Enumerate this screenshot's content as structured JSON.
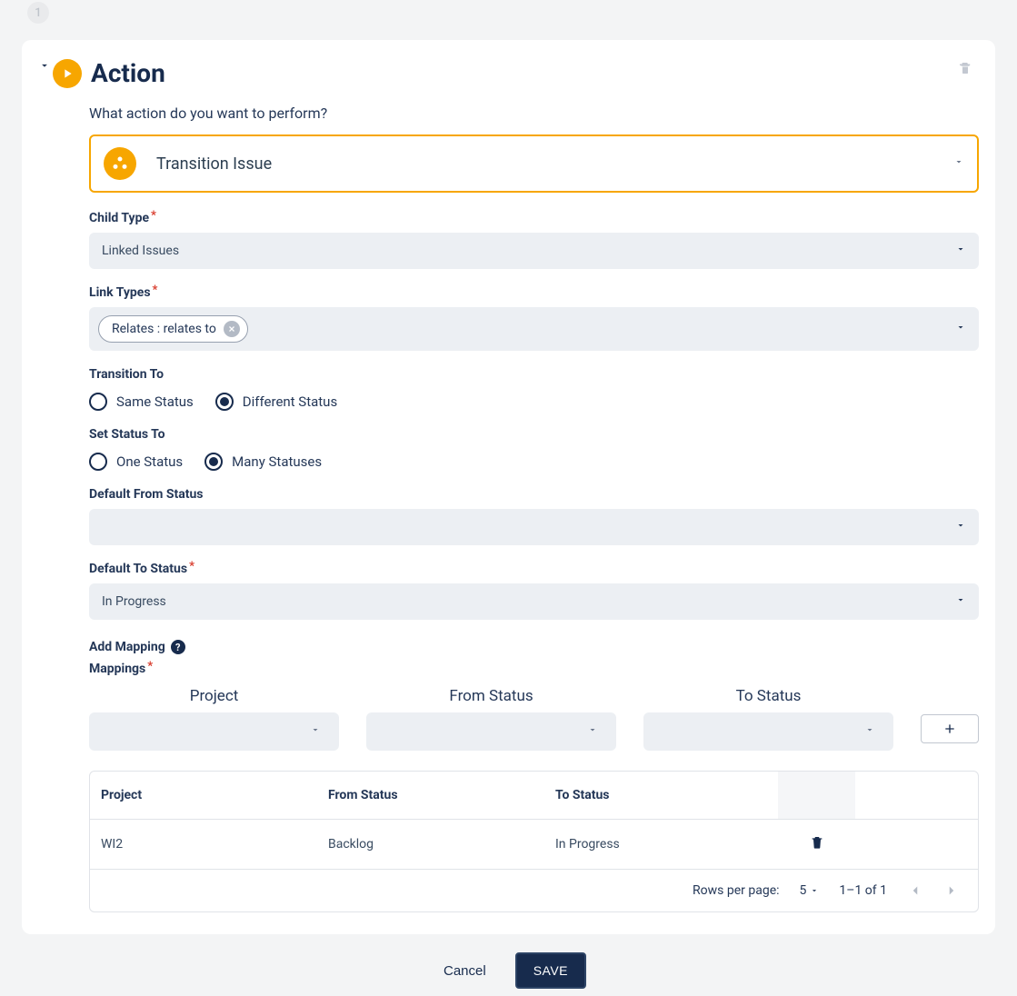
{
  "stepNumber": "1",
  "header": {
    "title": "Action"
  },
  "prompt": "What action do you want to perform?",
  "actionSelect": {
    "value": "Transition Issue"
  },
  "childType": {
    "label": "Child Type",
    "value": "Linked Issues"
  },
  "linkTypes": {
    "label": "Link Types",
    "chip": "Relates : relates to"
  },
  "transitionTo": {
    "label": "Transition To",
    "options": [
      "Same Status",
      "Different Status"
    ],
    "selected": 1
  },
  "setStatusTo": {
    "label": "Set Status To",
    "options": [
      "One Status",
      "Many Statuses"
    ],
    "selected": 1
  },
  "defaultFrom": {
    "label": "Default From Status",
    "value": ""
  },
  "defaultTo": {
    "label": "Default To Status",
    "value": "In Progress"
  },
  "addMapping": {
    "label": "Add Mapping"
  },
  "mappings": {
    "label": "Mappings",
    "columns": [
      "Project",
      "From Status",
      "To Status"
    ],
    "rows": [
      {
        "project": "WI2",
        "from": "Backlog",
        "to": "In Progress"
      }
    ]
  },
  "pagination": {
    "rowsLabel": "Rows per page:",
    "perPage": "5",
    "range": "1–1 of 1"
  },
  "footer": {
    "cancel": "Cancel",
    "save": "SAVE"
  }
}
